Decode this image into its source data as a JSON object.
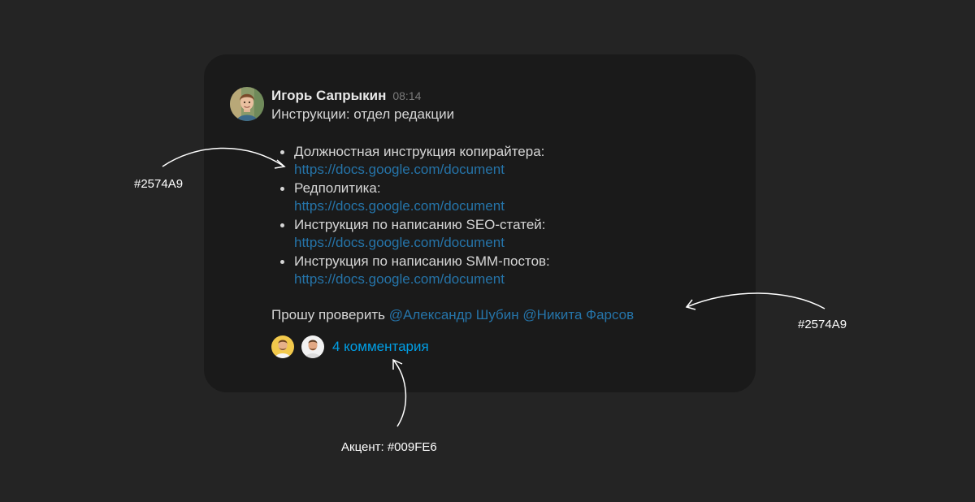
{
  "message": {
    "author": "Игорь Сапрыкин",
    "time": "08:14",
    "subject": "Инструкции: отдел редакции",
    "items": [
      {
        "label": "Должностная инструкция копирайтера:",
        "url": "https://docs.google.com/document"
      },
      {
        "label": "Редполитика:",
        "url": "https://docs.google.com/document"
      },
      {
        "label": "Инструкция по написанию SEO-статей:",
        "url": "https://docs.google.com/document"
      },
      {
        "label": "Инструкция по написанию SMM-постов:",
        "url": "https://docs.google.com/document"
      }
    ],
    "request_text": "Прошу проверить",
    "mentions": [
      "@Александр Шубин",
      "@Никита Фарсов"
    ],
    "comments_label": "4 комментария"
  },
  "annotations": {
    "link_color": "#2574A9",
    "mention_color": "#2574A9",
    "accent": "Акцент: #009FE6"
  },
  "colors": {
    "background": "#242424",
    "card": "#1a1a1a",
    "link": "#2574A9",
    "accent": "#009FE6"
  },
  "icons": {
    "author_avatar": "user-avatar",
    "commenter_avatars": [
      "commenter-avatar",
      "commenter-avatar"
    ]
  }
}
